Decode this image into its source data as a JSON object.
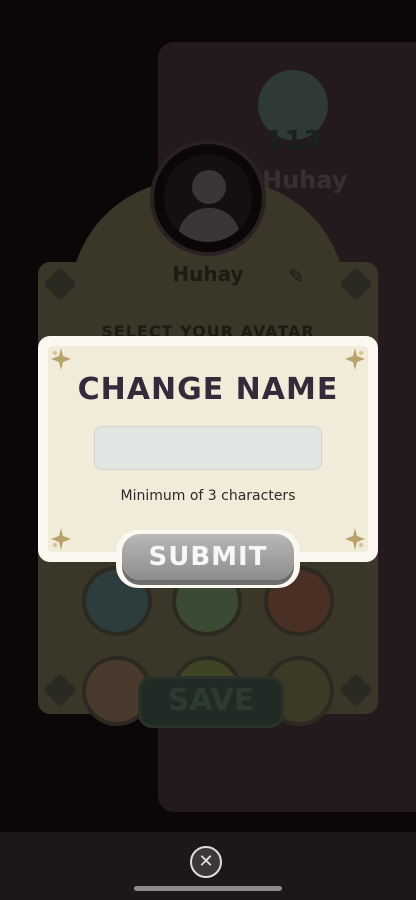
{
  "background": {
    "player_level": "113",
    "player_name_right": "Huhay",
    "profile_name": "Huhay",
    "select_avatar_title": "SELECT YOUR AVATAR",
    "save_label": "SAVE",
    "pencil_icon": "pencil-icon",
    "avatar_placeholder_icon": "user-silhouette-icon",
    "avatars": [
      {
        "name": "avatar-pirate",
        "color": "#2d3c3d"
      },
      {
        "name": "avatar-farmer",
        "color": "#3b4a32"
      },
      {
        "name": "avatar-chef",
        "color": "#4a3024"
      },
      {
        "name": "avatar-clown",
        "color": "#4a3a2e"
      },
      {
        "name": "avatar-gardener",
        "color": "#3e4524"
      },
      {
        "name": "avatar-explorer",
        "color": "#3c3a26"
      }
    ]
  },
  "modal": {
    "title": "CHANGE NAME",
    "input_value": "",
    "input_placeholder": "",
    "hint": "Minimum of 3 characters",
    "submit_label": "SUBMIT",
    "ornament_icon": "star-ornament-icon"
  },
  "footer": {
    "close_icon": "close-icon"
  },
  "colors": {
    "modal_title": "#332a3a",
    "modal_bg": "#f1ecd9",
    "submit_button": "#a3a2a0",
    "ornament": "#b8a36a"
  }
}
